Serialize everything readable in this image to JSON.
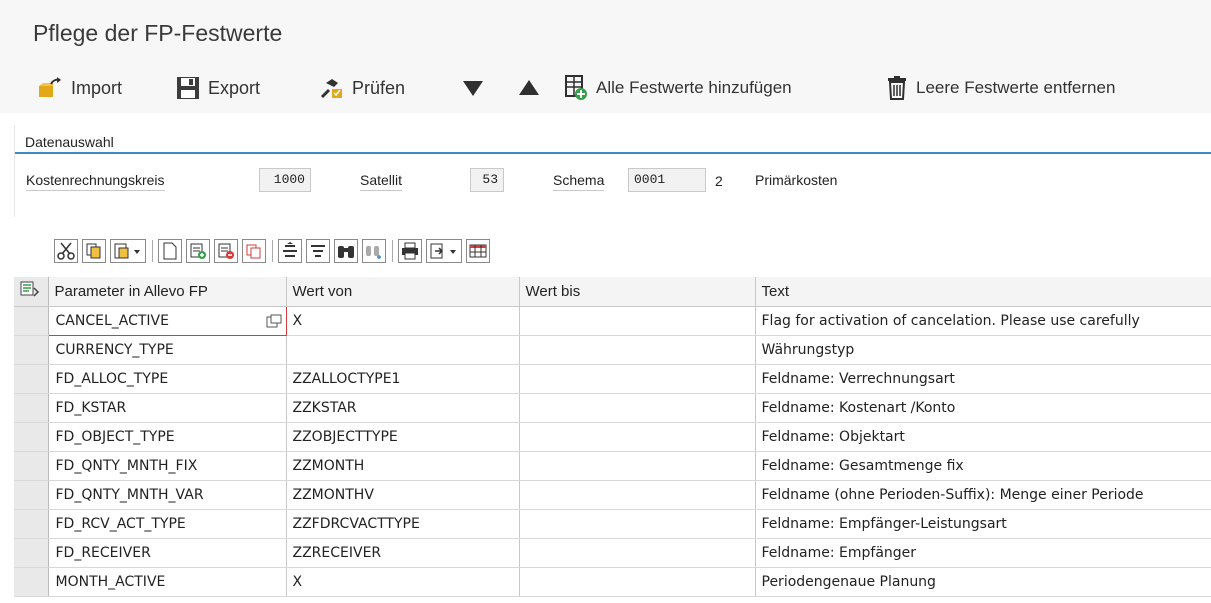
{
  "page": {
    "title": "Pflege der FP-Festwerte"
  },
  "toolbar": {
    "import_label": "Import",
    "export_label": "Export",
    "check_label": "Prüfen",
    "add_all_label": "Alle Festwerte hinzufügen",
    "remove_empty_label": "Leere Festwerte entfernen"
  },
  "selection": {
    "section_title": "Datenauswahl",
    "controlling_area_label": "Kostenrechnungskreis",
    "controlling_area_value": "1000",
    "satellite_label": "Satellit",
    "satellite_value": "53",
    "schema_label": "Schema",
    "schema_value": "0001",
    "schema_number": "2",
    "schema_text": "Primärkosten"
  },
  "table": {
    "headers": {
      "param": "Parameter in Allevo FP",
      "value_from": "Wert von",
      "value_to": "Wert bis",
      "text": "Text"
    },
    "rows": [
      {
        "param": "CANCEL_ACTIVE",
        "value_from": "X",
        "value_to": "",
        "text": "Flag for activation of cancelation. Please use carefully"
      },
      {
        "param": "CURRENCY_TYPE",
        "value_from": "",
        "value_to": "",
        "text": "Währungstyp"
      },
      {
        "param": "FD_ALLOC_TYPE",
        "value_from": "ZZALLOCTYPE1",
        "value_to": "",
        "text": "Feldname: Verrechnungsart"
      },
      {
        "param": "FD_KSTAR",
        "value_from": "ZZKSTAR",
        "value_to": "",
        "text": "Feldname: Kostenart /Konto"
      },
      {
        "param": "FD_OBJECT_TYPE",
        "value_from": "ZZOBJECTTYPE",
        "value_to": "",
        "text": "Feldname: Objektart"
      },
      {
        "param": "FD_QNTY_MNTH_FIX",
        "value_from": "ZZMONTH",
        "value_to": "",
        "text": "Feldname: Gesamtmenge fix"
      },
      {
        "param": "FD_QNTY_MNTH_VAR",
        "value_from": "ZZMONTHV",
        "value_to": "",
        "text": "Feldname (ohne Perioden-Suffix): Menge einer Periode"
      },
      {
        "param": "FD_RCV_ACT_TYPE",
        "value_from": "ZZFDRCVACTTYPE",
        "value_to": "",
        "text": "Feldname: Empfänger-Leistungsart"
      },
      {
        "param": "FD_RECEIVER",
        "value_from": "ZZRECEIVER",
        "value_to": "",
        "text": "Feldname: Empfänger"
      },
      {
        "param": "MONTH_ACTIVE",
        "value_from": "X",
        "value_to": "",
        "text": "Periodengenaue Planung"
      }
    ]
  }
}
